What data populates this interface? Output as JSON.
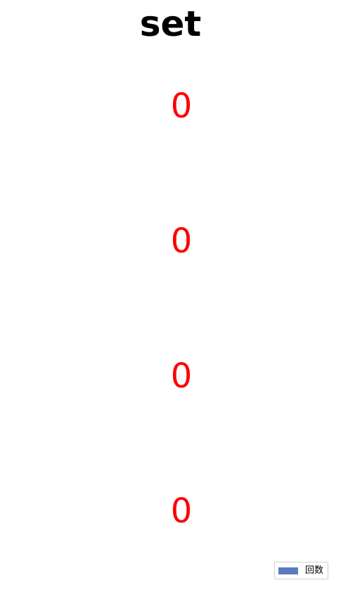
{
  "chart_data": {
    "type": "bar",
    "orientation": "horizontal",
    "title": "set",
    "categories": [
      "",
      "",
      "",
      ""
    ],
    "series": [
      {
        "name": "回数",
        "values": [
          0,
          0,
          0,
          0
        ],
        "color": "#5b7cc0"
      }
    ],
    "data_label_color": "#ff0000",
    "legend": {
      "position": "bottom-right"
    },
    "grid": false,
    "axes_visible": false
  }
}
